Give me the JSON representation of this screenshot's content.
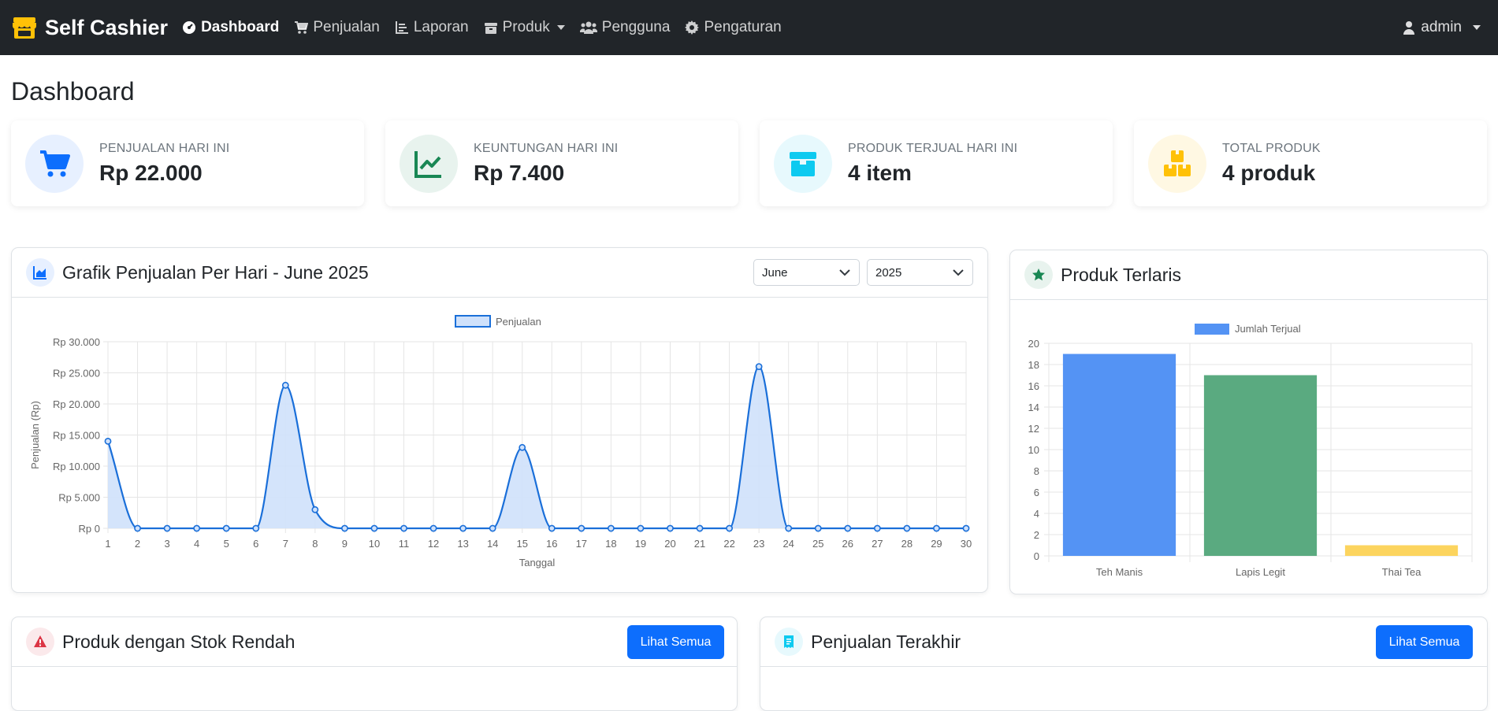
{
  "navbar": {
    "brand": "Self Cashier",
    "items": [
      {
        "label": "Dashboard",
        "icon": "tachometer-icon",
        "active": true
      },
      {
        "label": "Penjualan",
        "icon": "cart-icon"
      },
      {
        "label": "Laporan",
        "icon": "chart-icon"
      },
      {
        "label": "Produk",
        "icon": "box-icon",
        "dropdown": true
      },
      {
        "label": "Pengguna",
        "icon": "users-icon"
      },
      {
        "label": "Pengaturan",
        "icon": "gear-icon"
      }
    ],
    "user": "admin"
  },
  "page_title": "Dashboard",
  "stats": [
    {
      "label": "PENJUALAN HARI INI",
      "value": "Rp 22.000",
      "icon": "cart-icon",
      "color": "#0d6efd",
      "bg": "#e7f0ff"
    },
    {
      "label": "KEUNTUNGAN HARI INI",
      "value": "Rp 7.400",
      "icon": "chart-line-icon",
      "color": "#198754",
      "bg": "#e8f3ee"
    },
    {
      "label": "PRODUK TERJUAL HARI INI",
      "value": "4 item",
      "icon": "box-icon",
      "color": "#0dcaf0",
      "bg": "#e7f9fd"
    },
    {
      "label": "TOTAL PRODUK",
      "value": "4 produk",
      "icon": "boxes-icon",
      "color": "#ffc107",
      "bg": "#fff8e3"
    }
  ],
  "sales_panel": {
    "title": "Grafik Penjualan Per Hari - June 2025",
    "month": "June",
    "year": "2025"
  },
  "top_panel": {
    "title": "Produk Terlaris"
  },
  "low_stock_panel": {
    "title": "Produk dengan Stok Rendah",
    "button": "Lihat Semua"
  },
  "recent_panel": {
    "title": "Penjualan Terakhir",
    "button": "Lihat Semua"
  },
  "chart_data": [
    {
      "type": "line",
      "legend": "Penjualan",
      "xlabel": "Tanggal",
      "ylabel": "Penjualan (Rp)",
      "x": [
        1,
        2,
        3,
        4,
        5,
        6,
        7,
        8,
        9,
        10,
        11,
        12,
        13,
        14,
        15,
        16,
        17,
        18,
        19,
        20,
        21,
        22,
        23,
        24,
        25,
        26,
        27,
        28,
        29,
        30
      ],
      "values": [
        14000,
        0,
        0,
        0,
        0,
        0,
        23000,
        3000,
        0,
        0,
        0,
        0,
        0,
        0,
        13000,
        0,
        0,
        0,
        0,
        0,
        0,
        0,
        26000,
        0,
        0,
        0,
        0,
        0,
        0,
        0
      ],
      "ylim": [
        0,
        30000
      ],
      "yticks": [
        "Rp 0",
        "Rp 5.000",
        "Rp 10.000",
        "Rp 15.000",
        "Rp 20.000",
        "Rp 25.000",
        "Rp 30.000"
      ],
      "color": "#1a6fd9",
      "fill": "#cfe1fb",
      "grid": true,
      "legend_position": "top"
    },
    {
      "type": "bar",
      "legend": "Jumlah Terjual",
      "categories": [
        "Teh Manis",
        "Lapis Legit",
        "Thai Tea"
      ],
      "values": [
        19,
        17,
        1
      ],
      "colors": [
        "#5493f4",
        "#5aaa80",
        "#fcd45e"
      ],
      "ylim": [
        0,
        20
      ],
      "yticks": [
        "0",
        "2",
        "4",
        "6",
        "8",
        "10",
        "12",
        "14",
        "16",
        "18",
        "20"
      ],
      "grid": true,
      "legend_position": "top"
    }
  ]
}
